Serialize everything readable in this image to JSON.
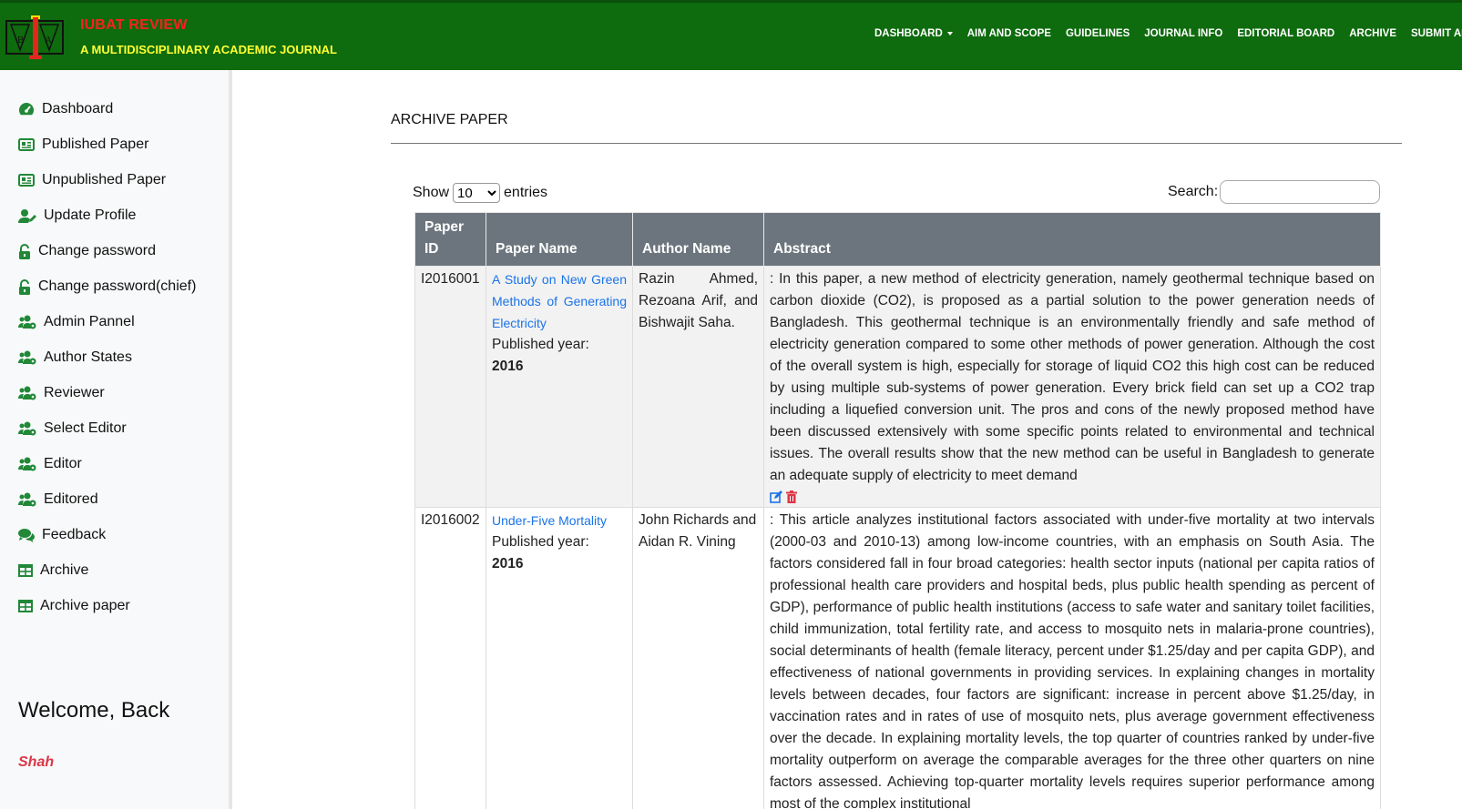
{
  "header": {
    "brand_title": "IUBAT REVIEW",
    "brand_subtitle": "A MULTIDISCIPLINARY ACADEMIC JOURNAL",
    "nav": [
      "DASHBOARD",
      "AIM AND SCOPE",
      "GUIDELINES",
      "JOURNAL INFO",
      "EDITORIAL BOARD",
      "ARCHIVE",
      "SUBMIT AN A"
    ]
  },
  "sidebar": {
    "items": [
      {
        "label": "Dashboard",
        "icon": "dashboard-icon"
      },
      {
        "label": "Published Paper",
        "icon": "newspaper-icon"
      },
      {
        "label": "Unpublished Paper",
        "icon": "newspaper-icon"
      },
      {
        "label": "Update Profile",
        "icon": "user-edit-icon"
      },
      {
        "label": "Change password",
        "icon": "unlock-icon"
      },
      {
        "label": "Change password(chief)",
        "icon": "unlock-icon"
      },
      {
        "label": "Admin Pannel",
        "icon": "users-cog-icon"
      },
      {
        "label": "Author States",
        "icon": "users-cog-icon"
      },
      {
        "label": "Reviewer",
        "icon": "users-cog-icon"
      },
      {
        "label": "Select Editor",
        "icon": "users-cog-icon"
      },
      {
        "label": "Editor",
        "icon": "users-cog-icon"
      },
      {
        "label": "Editored",
        "icon": "users-cog-icon"
      },
      {
        "label": "Feedback",
        "icon": "comments-icon"
      },
      {
        "label": "Archive",
        "icon": "table-icon"
      },
      {
        "label": "Archive paper",
        "icon": "table-icon"
      }
    ],
    "welcome": "Welcome, Back",
    "username": "Shah"
  },
  "main": {
    "title": "ARCHIVE PAPER",
    "show_label": "Show",
    "entries_label": "entries",
    "page_length": "10",
    "search_label": "Search:",
    "columns": [
      "Paper ID",
      "Paper Name",
      "Author Name",
      "Abstract"
    ],
    "rows": [
      {
        "id": "I2016001",
        "name": "A Study on New Green Methods of Generating Electricity",
        "published_label": "Published year:",
        "year": "2016",
        "authors": "Razin Ahmed, Rezoana Arif, and Bishwajit Saha.",
        "abstract": ": In this paper, a new method of electricity generation, namely geothermal technique based on carbon dioxide (CO2), is proposed as a partial solution to the power generation needs of Bangladesh. This geothermal technique is an environmentally friendly and safe method of electricity generation compared to some other methods of power generation. Although the cost of the overall system is high, especially for storage of liquid CO2 this high cost can be reduced by using multiple sub-systems of power generation. Every brick field can set up a CO2 trap including a liquefied conversion unit. The pros and cons of the newly proposed method have been discussed extensively with some specific points related to environmental and technical issues. The overall results show that the new method can be useful in Bangladesh to generate an adequate supply of electricity to meet demand"
      },
      {
        "id": "I2016002",
        "name": "Under-Five Mortality",
        "published_label": "Published year:",
        "year": "2016",
        "authors": "John Richards and Aidan R. Vining",
        "abstract": ": This article analyzes institutional factors associated with under-five mortality at two intervals (2000-03 and 2010-13) among low-income countries, with an emphasis on South Asia. The factors considered fall in four broad categories: health sector inputs (national per capita ratios of professional health care providers and hospital beds, plus public health spending as percent of GDP), performance of public health institutions (access to safe water and sanitary toilet facilities, child immunization, total fertility rate, and access to mosquito nets in malaria-prone countries), social determinants of health (female literacy, percent under $1.25/day and per capita GDP), and effectiveness of national governments in providing services. In explaining changes in mortality levels between decades, four factors are significant: increase in percent above $1.25/day, in vaccination rates and in rates of use of mosquito nets, plus average government effectiveness over the decade. In explaining mortality levels, the top quarter of countries ranked by under-five mortality outperform on average the comparable averages for the three other quarters on nine factors assessed. Achieving top-quarter mortality levels requires superior performance among most of the complex institutional"
      }
    ]
  }
}
